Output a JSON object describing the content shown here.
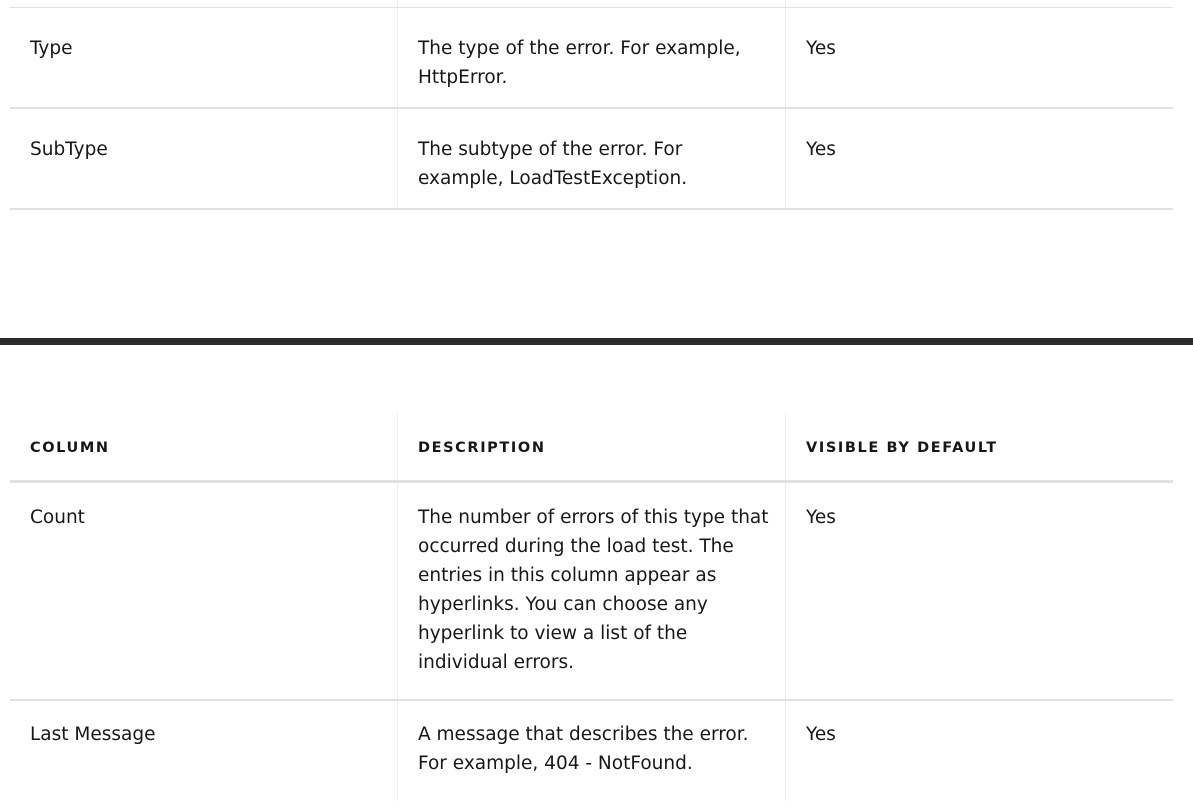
{
  "top_table": {
    "rows": [
      {
        "column": "Type",
        "description": "The type of the error. For example, HttpError.",
        "visible": "Yes"
      },
      {
        "column": "SubType",
        "description": "The subtype of the error. For example, LoadTestException.",
        "visible": "Yes"
      }
    ]
  },
  "bottom_table": {
    "headers": {
      "column": "COLUMN",
      "description": "DESCRIPTION",
      "visible": "VISIBLE BY DEFAULT"
    },
    "rows": [
      {
        "column": "Count",
        "description": "The number of errors of this type that occurred during the load test. The entries in this column appear as hyperlinks. You can choose any hyperlink to view a list of the individual errors.",
        "visible": "Yes"
      },
      {
        "column": "Last Message",
        "description": "A message that describes the error. For example, 404 - NotFound.",
        "visible": "Yes"
      }
    ]
  }
}
